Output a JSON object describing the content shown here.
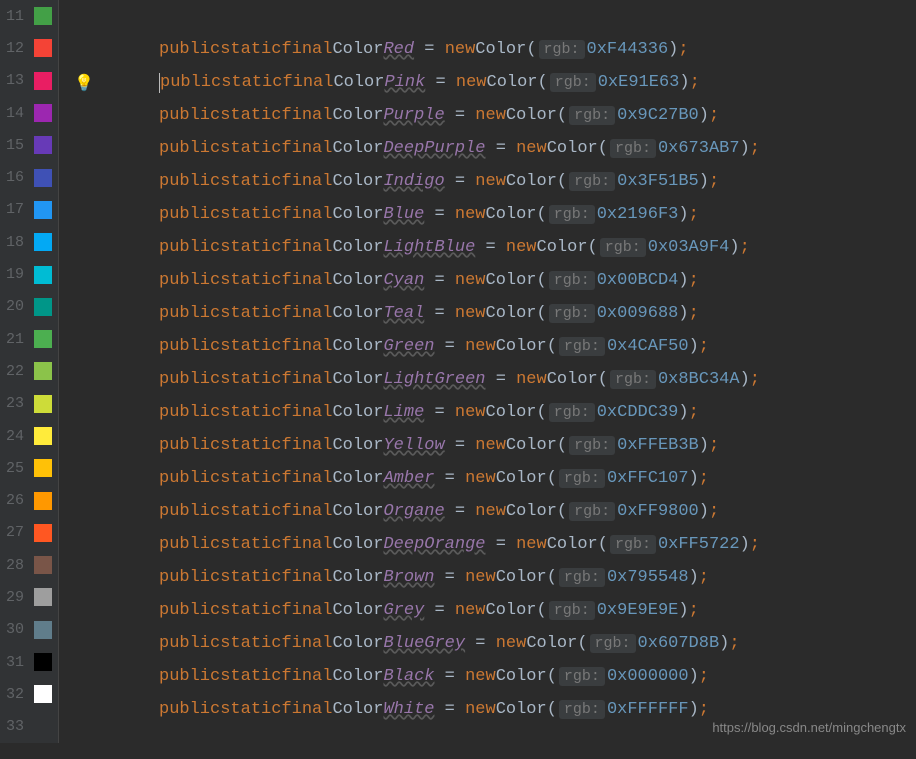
{
  "watermark": "https://blog.csdn.net/mingchengtx",
  "keywords": {
    "public": "public",
    "static": "static",
    "final": "final",
    "new": "new"
  },
  "type_label": "Color",
  "hint_label": "rgb:",
  "equals": " = ",
  "open_paren": "(",
  "close_paren": ")",
  "semicolon": ";",
  "space": " ",
  "lines": [
    {
      "num": "11",
      "swatch": "#43A047",
      "empty": true
    },
    {
      "num": "12",
      "swatch": "#F44336",
      "name": "Red",
      "hex": "0xF44336"
    },
    {
      "num": "13",
      "swatch": "#E91E63",
      "name": "Pink",
      "hex": "0xE91E63",
      "bulb": true,
      "caret": true
    },
    {
      "num": "14",
      "swatch": "#9C27B0",
      "name": "Purple",
      "hex": "0x9C27B0"
    },
    {
      "num": "15",
      "swatch": "#673AB7",
      "name": "DeepPurple",
      "hex": "0x673AB7"
    },
    {
      "num": "16",
      "swatch": "#3F51B5",
      "name": "Indigo",
      "hex": "0x3F51B5"
    },
    {
      "num": "17",
      "swatch": "#2196F3",
      "name": "Blue",
      "hex": "0x2196F3"
    },
    {
      "num": "18",
      "swatch": "#03A9F4",
      "name": "LightBlue",
      "hex": "0x03A9F4"
    },
    {
      "num": "19",
      "swatch": "#00BCD4",
      "name": "Cyan",
      "hex": "0x00BCD4"
    },
    {
      "num": "20",
      "swatch": "#009688",
      "name": "Teal",
      "hex": "0x009688"
    },
    {
      "num": "21",
      "swatch": "#4CAF50",
      "name": "Green",
      "hex": "0x4CAF50"
    },
    {
      "num": "22",
      "swatch": "#8BC34A",
      "name": "LightGreen",
      "hex": "0x8BC34A"
    },
    {
      "num": "23",
      "swatch": "#CDDC39",
      "name": "Lime",
      "hex": "0xCDDC39"
    },
    {
      "num": "24",
      "swatch": "#FFEB3B",
      "name": "Yellow",
      "hex": "0xFFEB3B"
    },
    {
      "num": "25",
      "swatch": "#FFC107",
      "name": "Amber",
      "hex": "0xFFC107"
    },
    {
      "num": "26",
      "swatch": "#FF9800",
      "name": "Organe",
      "hex": "0xFF9800"
    },
    {
      "num": "27",
      "swatch": "#FF5722",
      "name": "DeepOrange",
      "hex": "0xFF5722"
    },
    {
      "num": "28",
      "swatch": "#795548",
      "name": "Brown",
      "hex": "0x795548"
    },
    {
      "num": "29",
      "swatch": "#9E9E9E",
      "name": "Grey",
      "hex": "0x9E9E9E"
    },
    {
      "num": "30",
      "swatch": "#607D8B",
      "name": "BlueGrey",
      "hex": "0x607D8B"
    },
    {
      "num": "31",
      "swatch": "#000000",
      "name": "Black",
      "hex": "0x000000"
    },
    {
      "num": "32",
      "swatch": "#FFFFFF",
      "name": "White",
      "hex": "0xFFFFFF"
    },
    {
      "num": "33",
      "swatch": null,
      "empty": true
    }
  ]
}
